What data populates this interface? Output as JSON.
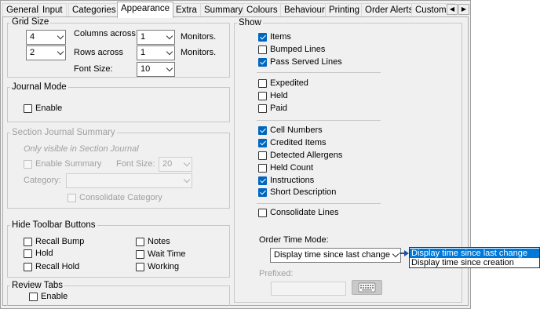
{
  "tabs": [
    "General",
    "Input",
    "Categories",
    "Appearance",
    "Extra",
    "Summary",
    "Colours",
    "Behaviour",
    "Printing",
    "Order Alerts",
    "Custome"
  ],
  "active_tab": "Appearance",
  "scroll_left": "◀",
  "scroll_right": "▶",
  "grid_size": {
    "title": "Grid Size",
    "columns_value": "4",
    "rows_value": "2",
    "columns_label": "Columns across",
    "rows_label": "Rows across",
    "columns_monitors": "1",
    "rows_monitors": "1",
    "monitors_label_1": "Monitors.",
    "monitors_label_2": "Monitors.",
    "font_size_label": "Font Size:",
    "font_size_value": "10"
  },
  "journal_mode": {
    "title": "Journal Mode",
    "enable_label": "Enable",
    "enable_checked": false
  },
  "section_journal": {
    "title": "Section Journal Summary",
    "note": "Only visible in Section Journal",
    "enable_summary_label": "Enable Summary",
    "font_size_label": "Font Size:",
    "font_size_value": "20",
    "category_label": "Category:",
    "category_value": "",
    "consolidate_label": "Consolidate Category"
  },
  "hide_toolbar": {
    "title": "Hide Toolbar Buttons",
    "items": [
      {
        "label": "Recall Bump",
        "checked": false
      },
      {
        "label": "Hold",
        "checked": false
      },
      {
        "label": "Recall Hold",
        "checked": false
      },
      {
        "label": "Notes",
        "checked": false
      },
      {
        "label": "Wait Time",
        "checked": false
      },
      {
        "label": "Working",
        "checked": false
      }
    ]
  },
  "review_tabs": {
    "title": "Review Tabs",
    "enable_label": "Enable",
    "enable_checked": false
  },
  "show": {
    "title": "Show",
    "items": [
      {
        "label": "Items",
        "checked": true
      },
      {
        "label": "Bumped Lines",
        "checked": false
      },
      {
        "label": "Pass Served Lines",
        "checked": true
      },
      {
        "label": "Expedited",
        "checked": false
      },
      {
        "label": "Held",
        "checked": false
      },
      {
        "label": "Paid",
        "checked": false
      },
      {
        "label": "Cell Numbers",
        "checked": true
      },
      {
        "label": "Credited Items",
        "checked": true
      },
      {
        "label": "Detected Allergens",
        "checked": false
      },
      {
        "label": "Held Count",
        "checked": false
      },
      {
        "label": "Instructions",
        "checked": true
      },
      {
        "label": "Short Description",
        "checked": true
      },
      {
        "label": "Consolidate Lines",
        "checked": false
      }
    ],
    "order_time_mode_label": "Order Time Mode:",
    "order_time_mode_value": "Display time since last change",
    "prefixed_label": "Prefixed:",
    "prefixed_value": ""
  },
  "dropdown_options": [
    {
      "label": "Display time since last change",
      "selected": true
    },
    {
      "label": "Display time since creation",
      "selected": false
    }
  ],
  "colors": {
    "accent": "#0067c0",
    "highlight": "#0078d7",
    "arrow": "#1f4fa0"
  }
}
